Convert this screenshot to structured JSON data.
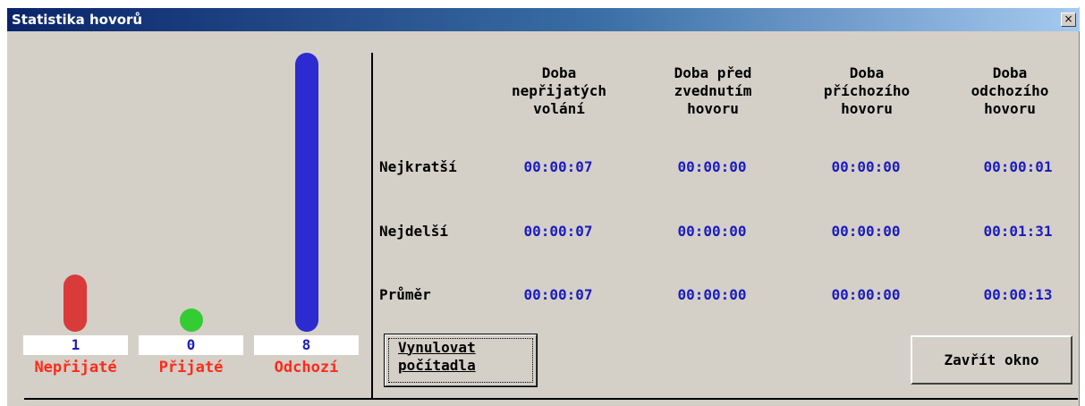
{
  "window": {
    "title": "Statistika hovorů",
    "close_glyph": "×"
  },
  "counters": [
    {
      "name": "missed",
      "label": "Nepřijaté",
      "count": "1",
      "value": 1,
      "color": "#d93a3a"
    },
    {
      "name": "received",
      "label": "Přijaté",
      "count": "0",
      "value": 0,
      "color": "#33cc33"
    },
    {
      "name": "outgoing",
      "label": "Odchozí",
      "count": "8",
      "value": 8,
      "color": "#2b2bd0"
    }
  ],
  "table": {
    "columns": [
      "Doba\nnepřijatých\nvolání",
      "Doba před\nzvednutím\nhovoru",
      "Doba\npříchozího\nhovoru",
      "Doba\nodchozího\nhovoru"
    ],
    "rows": [
      {
        "label": "Nejkratší",
        "values": [
          "00:00:07",
          "00:00:00",
          "00:00:00",
          "00:00:01"
        ]
      },
      {
        "label": "Nejdelší",
        "values": [
          "00:00:07",
          "00:00:00",
          "00:00:00",
          "00:01:31"
        ]
      },
      {
        "label": "Průměr",
        "values": [
          "00:00:07",
          "00:00:00",
          "00:00:00",
          "00:00:13"
        ]
      }
    ]
  },
  "buttons": {
    "reset": "Vynulovat\npočítadla",
    "close": "Zavřít okno"
  }
}
